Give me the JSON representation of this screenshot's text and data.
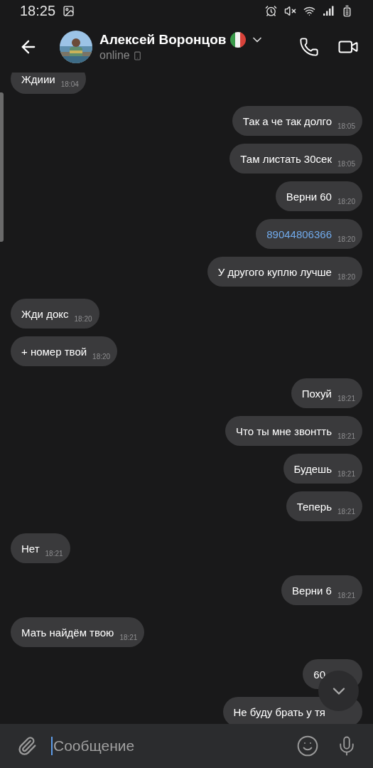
{
  "status_bar": {
    "time": "18:25"
  },
  "header": {
    "name": "Алексей Воронцов",
    "status": "online"
  },
  "messages": [
    {
      "text": "Ждиии",
      "time": "18:04",
      "outgoing": false
    },
    {
      "text": "Так а че так долго",
      "time": "18:05",
      "outgoing": true
    },
    {
      "text": "Там листать 30сек",
      "time": "18:05",
      "outgoing": true
    },
    {
      "text": "Верни 60",
      "time": "18:20",
      "outgoing": true
    },
    {
      "text": "89044806366",
      "time": "18:20",
      "outgoing": true,
      "kind": "link"
    },
    {
      "text": "У другого куплю лучше",
      "time": "18:20",
      "outgoing": true
    },
    {
      "text": "Жди докс",
      "time": "18:20",
      "outgoing": false
    },
    {
      "text": "+ номер твой",
      "time": "18:20",
      "outgoing": false
    },
    {
      "text": "Похуй",
      "time": "18:21",
      "outgoing": true
    },
    {
      "text": "Что ты мне звонтть",
      "time": "18:21",
      "outgoing": true
    },
    {
      "text": "Будешь",
      "time": "18:21",
      "outgoing": true
    },
    {
      "text": "Теперь",
      "time": "18:21",
      "outgoing": true
    },
    {
      "text": "Нет",
      "time": "18:21",
      "outgoing": false
    },
    {
      "text": "Верни 6",
      "time": "18:21",
      "outgoing": true
    },
    {
      "text": "Мать найдём твою",
      "time": "18:21",
      "outgoing": false
    },
    {
      "text": "60",
      "outgoing": true
    },
    {
      "text": "Не буду брать у тя",
      "outgoing": true
    }
  ],
  "composer": {
    "placeholder": "Сообщение"
  }
}
